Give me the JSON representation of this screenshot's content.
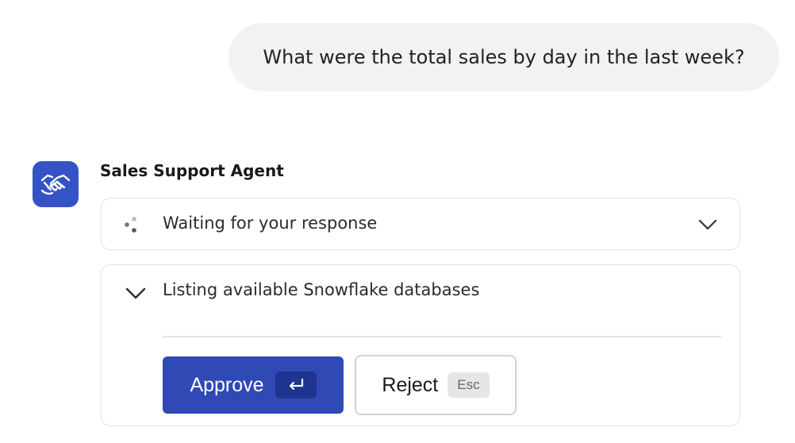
{
  "user_message": {
    "text": "What were the total sales by day in the last week?"
  },
  "agent": {
    "name": "Sales Support Agent",
    "avatar_icon": "handshake-icon",
    "avatar_color": "#3553c6"
  },
  "status": {
    "text": "Waiting for your response",
    "icon": "loading-dots-icon",
    "toggle_icon": "chevron-down-icon"
  },
  "tool_call": {
    "title": "Listing available Snowflake databases",
    "toggle_icon": "chevron-down-icon",
    "approve": {
      "label": "Approve",
      "shortcut_icon": "enter-key-icon",
      "color": "#2f49b5"
    },
    "reject": {
      "label": "Reject",
      "shortcut": "Esc"
    }
  }
}
